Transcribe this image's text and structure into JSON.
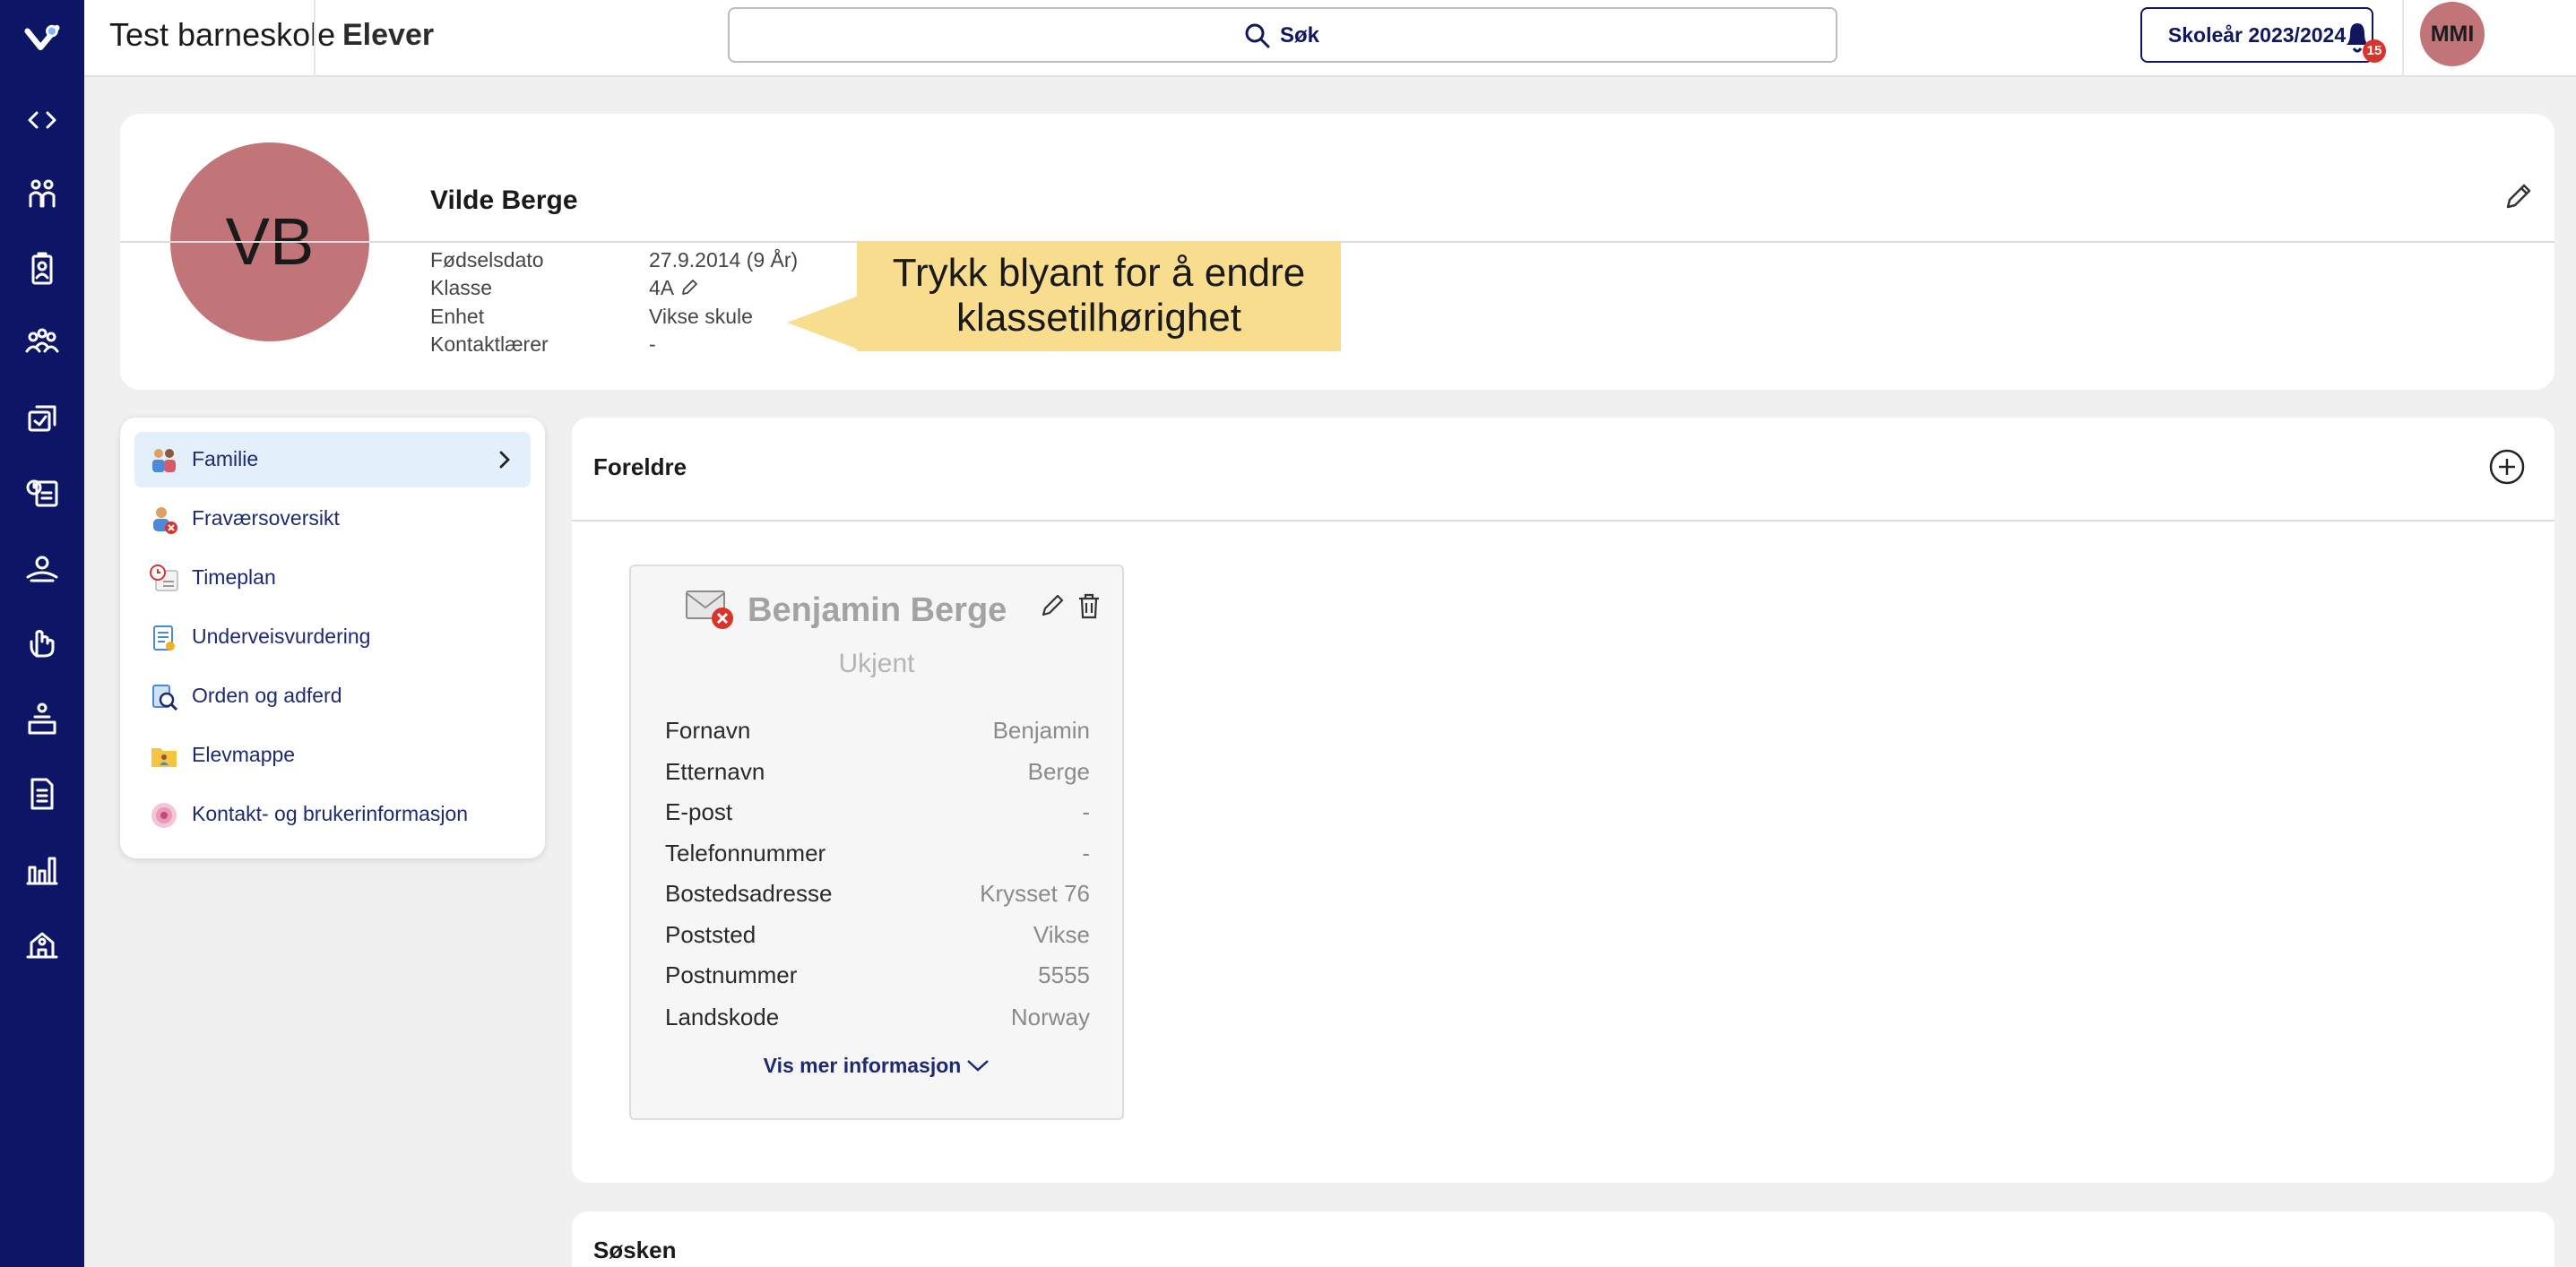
{
  "topbar": {
    "school": "Test barneskole",
    "section": "Elever",
    "search_label": "Søk",
    "school_year": "Skoleår 2023/2024",
    "notifications_count": "15",
    "user_initials": "MMI"
  },
  "rail": {
    "icons": [
      "collapse-toggle-icon",
      "students-icon",
      "id-badge-icon",
      "groups-icon",
      "assignments-icon",
      "calendar-icon",
      "support-icon",
      "vote-hand-icon",
      "classroom-icon",
      "document-icon",
      "statistics-icon",
      "school-building-icon"
    ]
  },
  "student": {
    "initials": "VB",
    "name": "Vilde Berge",
    "fields": [
      {
        "label": "Fødselsdato",
        "value": "27.9.2014 (9 År)"
      },
      {
        "label": "Klasse",
        "value": "4A"
      },
      {
        "label": "Enhet",
        "value": "Vikse skule"
      },
      {
        "label": "Kontaktlærer",
        "value": "-"
      }
    ]
  },
  "callout": {
    "line1": "Trykk blyant for å endre",
    "line2": "klassetilhørighet"
  },
  "menu": {
    "items": [
      {
        "label": "Familie"
      },
      {
        "label": "Fraværsoversikt"
      },
      {
        "label": "Timeplan"
      },
      {
        "label": "Underveisvurdering"
      },
      {
        "label": "Orden og adferd"
      },
      {
        "label": "Elevmappe"
      },
      {
        "label": "Kontakt- og brukerinformasjon"
      }
    ]
  },
  "parents": {
    "title": "Foreldre",
    "parent": {
      "name": "Benjamin Berge",
      "status": "Ukjent",
      "fields": [
        {
          "label": "Fornavn",
          "value": "Benjamin"
        },
        {
          "label": "Etternavn",
          "value": "Berge"
        },
        {
          "label": "E-post",
          "value": "-"
        },
        {
          "label": "Telefonnummer",
          "value": "-"
        },
        {
          "label": "Bostedsadresse",
          "value": "Krysset 76"
        },
        {
          "label": "Poststed",
          "value": "Vikse"
        },
        {
          "label": "Postnummer",
          "value": "5555"
        },
        {
          "label": "Landskode",
          "value": "Norway"
        }
      ],
      "more_label": "Vis mer informasjon"
    }
  },
  "siblings": {
    "title": "Søsken"
  },
  "colors": {
    "rail": "#0c1566",
    "avatar": "#c27578",
    "callout": "#f8dd8f",
    "active_menu": "#e3f0fb",
    "badge": "#d8342c"
  }
}
